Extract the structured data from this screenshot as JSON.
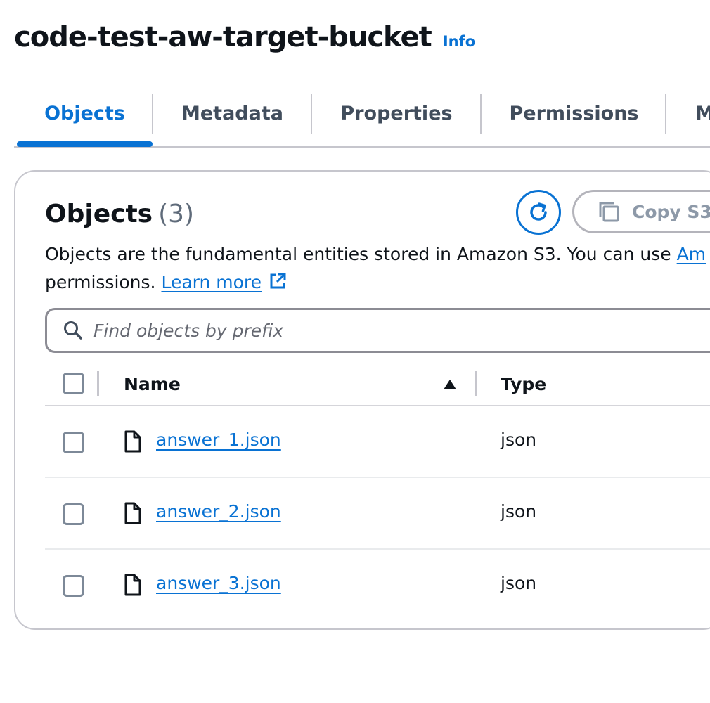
{
  "bucket": {
    "title": "code-test-aw-target-bucket",
    "info_label": "Info"
  },
  "tabs": [
    {
      "label": "Objects",
      "active": true
    },
    {
      "label": "Metadata",
      "active": false
    },
    {
      "label": "Properties",
      "active": false
    },
    {
      "label": "Permissions",
      "active": false
    },
    {
      "label": "M",
      "active": false
    }
  ],
  "objects_panel": {
    "heading": "Objects",
    "count": "(3)",
    "refresh_icon": "refresh-icon",
    "copy_button_label": "Copy S3",
    "copy_icon": "copy-icon",
    "description_line1": "Objects are the fundamental entities stored in Amazon S3. You can use ",
    "description_link": "Am",
    "description_line2": "permissions. ",
    "learn_more_label": "Learn more",
    "external_link_icon": "external-link-icon",
    "search": {
      "placeholder": "Find objects by prefix",
      "icon": "search-icon"
    }
  },
  "table": {
    "columns": {
      "name": "Name",
      "type": "Type"
    },
    "sort": "ascending",
    "rows": [
      {
        "name": "answer_1.json",
        "type": "json"
      },
      {
        "name": "answer_2.json",
        "type": "json"
      },
      {
        "name": "answer_3.json",
        "type": "json"
      }
    ]
  },
  "colors": {
    "accent": "#0972d3",
    "text": "#0f141a",
    "border": "#c6c6cd"
  }
}
